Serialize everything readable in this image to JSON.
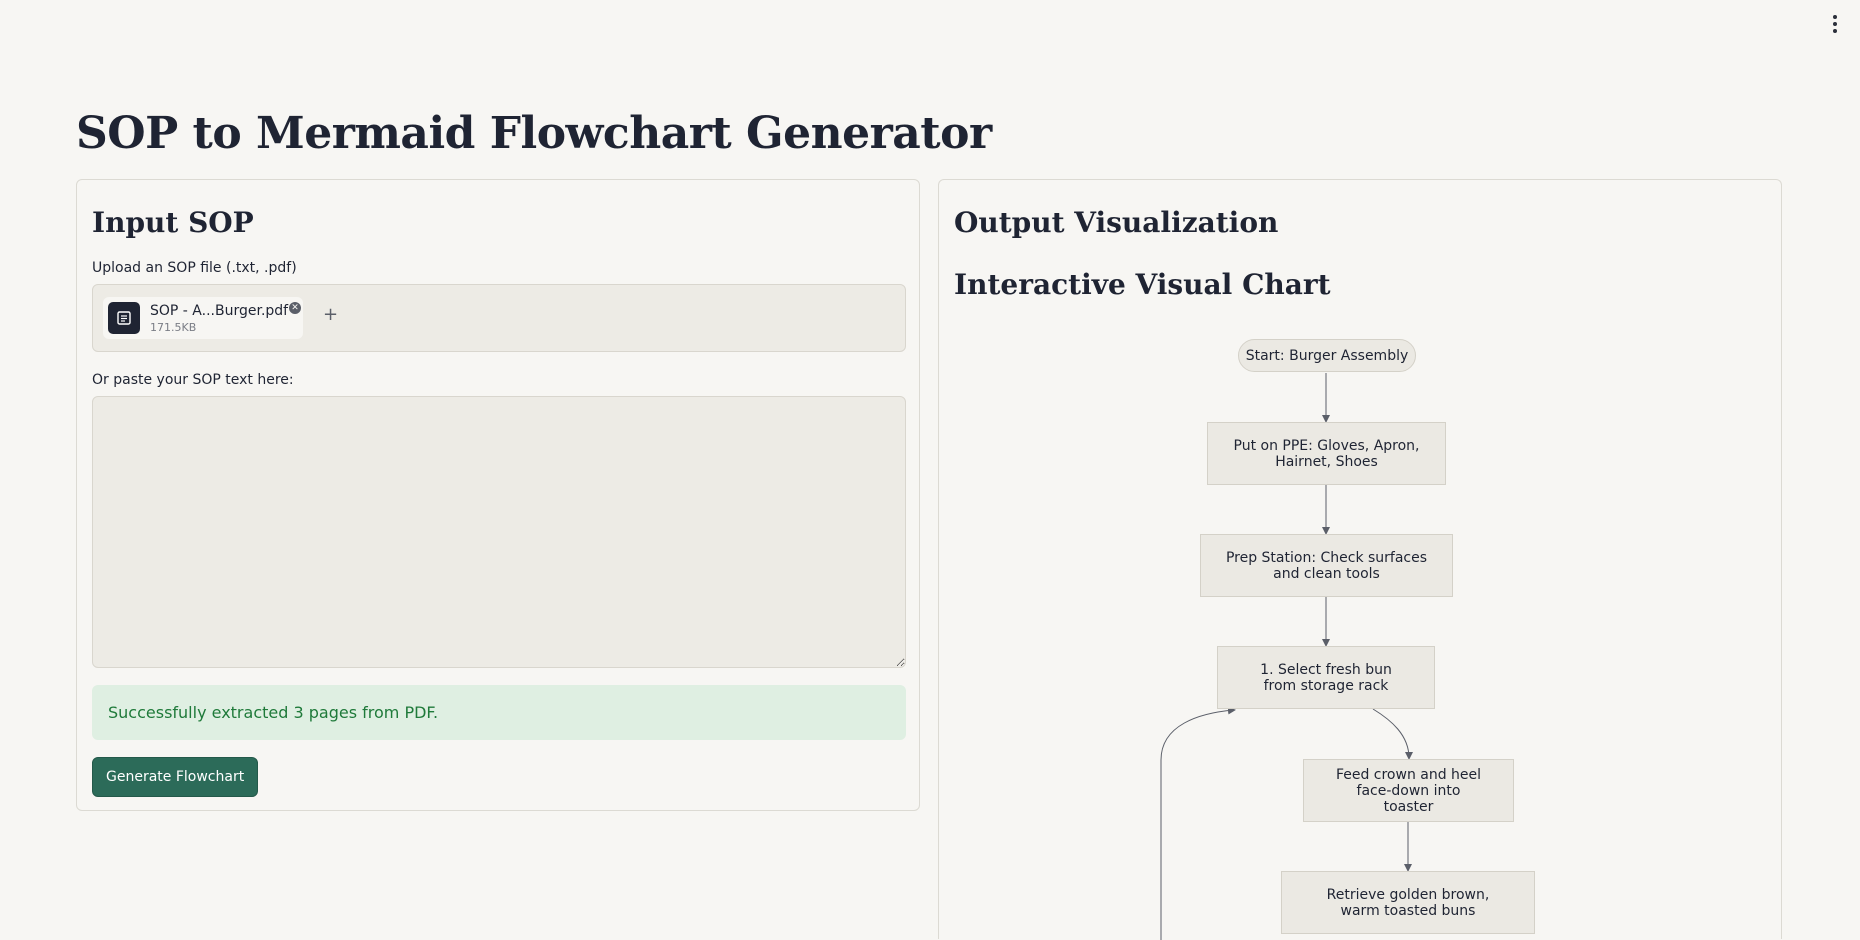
{
  "page_title": "SOP to Mermaid Flowchart Generator",
  "input": {
    "heading": "Input SOP",
    "upload_label": "Upload an SOP file (.txt, .pdf)",
    "file": {
      "name": "SOP - A...Burger.pdf",
      "size": "171.5KB"
    },
    "add_label": "+",
    "remove_label": "✕",
    "paste_label": "Or paste your SOP text here:",
    "paste_value": "",
    "success_message": "Successfully extracted 3 pages from PDF.",
    "generate_label": "Generate Flowchart"
  },
  "output": {
    "heading": "Output Visualization",
    "subheading": "Interactive Visual Chart",
    "flowchart": {
      "start": "Start: Burger Assembly",
      "ppe": "Put on PPE: Gloves, Apron, Hairnet, Shoes",
      "prep": "Prep Station: Check surfaces and clean tools",
      "step1": "1. Select fresh bun from storage rack",
      "feed": "Feed crown and heel face-down into toaster",
      "retrieve": "Retrieve golden brown, warm toasted buns"
    }
  },
  "colors": {
    "accent_button": "#2c6b59",
    "success_bg": "#dfefe2",
    "success_text": "#1f7a3a",
    "node_bg": "#ebe9e3",
    "edge": "#5b5f69"
  },
  "icons": [
    "more-vert-icon",
    "document-icon",
    "close-icon",
    "plus-icon"
  ]
}
